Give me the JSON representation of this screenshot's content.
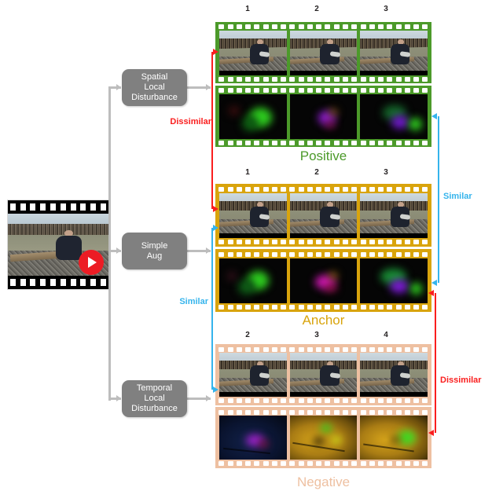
{
  "figure": {
    "title": "Video contrastive learning sample construction diagram"
  },
  "source": {
    "name": "source-video-thumbnail",
    "play_icon": "play-icon"
  },
  "process_boxes": [
    {
      "id": "spatial",
      "label": "Spatial\nLocal\nDisturbance",
      "line1": "Spatial",
      "line2": "Local",
      "line3": "Disturbance"
    },
    {
      "id": "simple",
      "label": "Simple\nAug",
      "line1": "Simple",
      "line2": "Aug",
      "line3": ""
    },
    {
      "id": "temporal",
      "label": "Temporal\nLocal\nDisturbance",
      "line1": "Temporal",
      "line2": "Local",
      "line3": "Disturbance"
    }
  ],
  "strips": {
    "positive": {
      "label": "Positive",
      "color": "#4C9A2A",
      "frame_numbers": [
        "1",
        "2",
        "3"
      ]
    },
    "anchor": {
      "label": "Anchor",
      "color": "#D9A40C",
      "frame_numbers": [
        "1",
        "2",
        "3"
      ]
    },
    "negative": {
      "label": "Negative",
      "color": "#EEC0A1",
      "frame_numbers": [
        "2",
        "3",
        "4"
      ]
    }
  },
  "relations": [
    {
      "id": "dissimilar-left",
      "label": "Dissimilar",
      "color": "#FA1E1E"
    },
    {
      "id": "similar-left",
      "label": "Similar",
      "color": "#35B4EC"
    },
    {
      "id": "similar-right",
      "label": "Similar",
      "color": "#35B4EC"
    },
    {
      "id": "dissimilar-right",
      "label": "Dissimilar",
      "color": "#FA1E1E"
    }
  ],
  "colors": {
    "connector_gray": "#BDBDBD",
    "box_gray": "#808080",
    "red": "#FA1E1E",
    "blue": "#35B4EC",
    "green": "#4C9A2A",
    "gold": "#D9A40C",
    "peach": "#EEC0A1"
  }
}
